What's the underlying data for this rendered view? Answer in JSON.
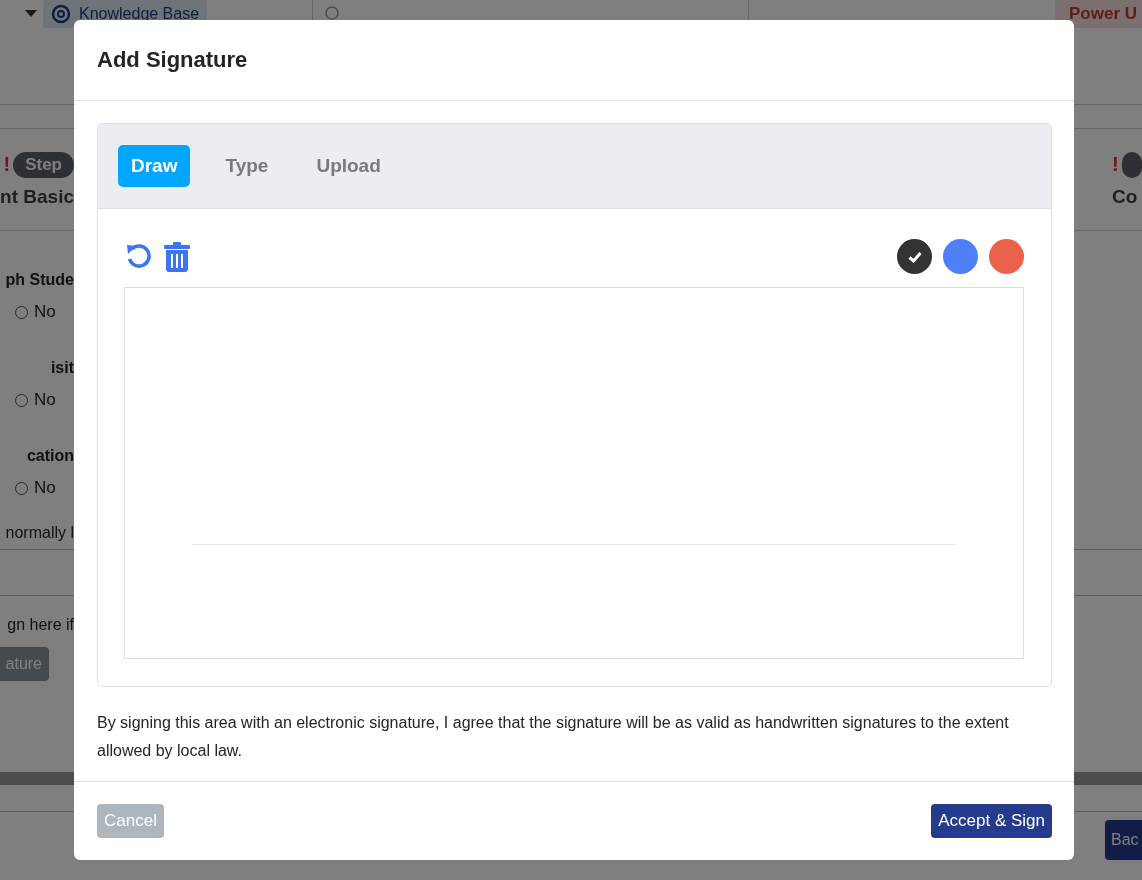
{
  "background": {
    "topbar": {
      "link": "Knowledge Base",
      "power": "Power U"
    },
    "steps": [
      {
        "alert": "!",
        "badge": "Step",
        "title": "nt Basic"
      },
      {
        "alert": "!",
        "title": "Co"
      }
    ],
    "questions": [
      {
        "label": "ph Stude",
        "option": "No",
        "selected": false
      },
      {
        "label": "isit",
        "option": "No",
        "selected": false
      },
      {
        "label": "cation",
        "option": "No",
        "selected": false
      }
    ],
    "note": "normally l",
    "sign_prompt": "gn here if",
    "sign_button": "ature",
    "back_button": "Bac"
  },
  "dialog": {
    "title": "Add Signature",
    "tabs": [
      {
        "label": "Draw",
        "selected": true
      },
      {
        "label": "Type",
        "selected": false
      },
      {
        "label": "Upload",
        "selected": false
      }
    ],
    "colors": [
      {
        "color": "#333333",
        "selected": true
      },
      {
        "color": "#4f7ff7",
        "selected": false
      },
      {
        "color": "#ea624b",
        "selected": false
      }
    ],
    "disclaimer": "By signing this area with an electronic signature, I agree that the signature will be as valid as handwritten signatures to the extent allowed by local law.",
    "buttons": [
      {
        "kind": "cancel",
        "label": "Cancel"
      },
      {
        "kind": "primary",
        "label": "Accept & Sign"
      }
    ]
  }
}
